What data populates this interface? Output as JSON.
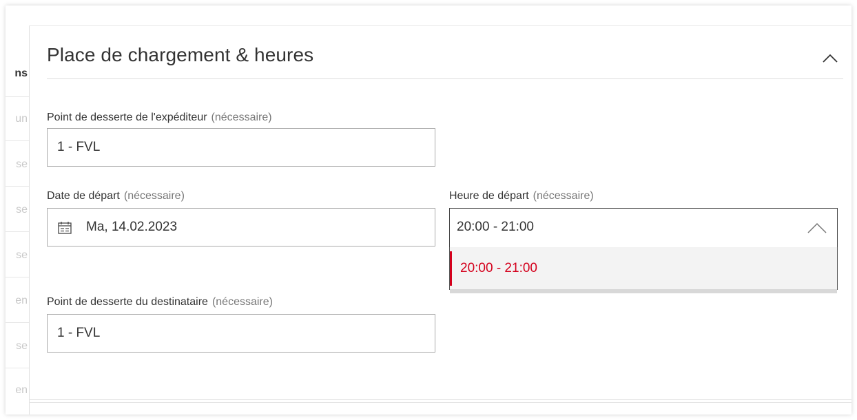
{
  "left_column": {
    "header": "ns",
    "items": [
      "un",
      "se",
      "se",
      "se",
      "en",
      "se",
      "en"
    ]
  },
  "section": {
    "title": "Place de chargement & heures",
    "collapse_icon": "chevron-up-icon"
  },
  "fields": {
    "shipper_point": {
      "label": "Point de desserte de l'expéditeur",
      "required": "(nécessaire)",
      "value": "1 - FVL"
    },
    "departure_date": {
      "label": "Date de départ",
      "required": "(nécessaire)",
      "value": "Ma, 14.02.2023",
      "icon": "calendar-icon"
    },
    "departure_time": {
      "label": "Heure de départ",
      "required": "(nécessaire)",
      "value": "20:00 - 21:00",
      "options": [
        "20:00 - 21:00"
      ]
    },
    "recipient_point": {
      "label": "Point de desserte du destinataire",
      "required": "(nécessaire)",
      "value": "1 - FVL"
    }
  },
  "colors": {
    "accent": "#d4001c",
    "border": "#a8a8a8",
    "text": "#333333"
  }
}
